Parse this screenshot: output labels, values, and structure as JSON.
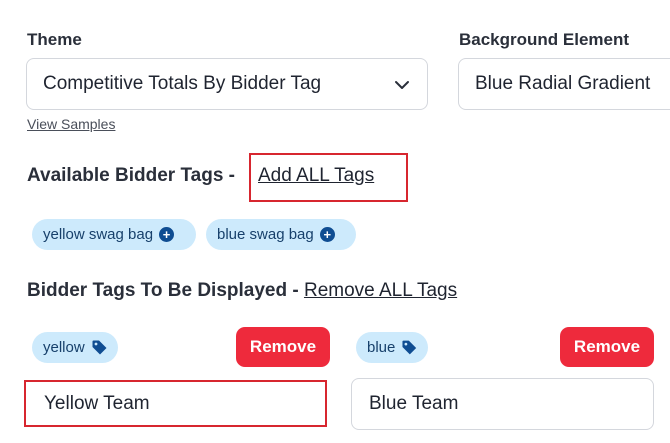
{
  "theme": {
    "label": "Theme",
    "selected": "Competitive Totals By Bidder Tag",
    "view_samples": "View Samples"
  },
  "background": {
    "label": "Background Element",
    "selected": "Blue Radial Gradient"
  },
  "available": {
    "title": "Available Bidder Tags - ",
    "add_all": "Add ALL Tags",
    "tags": [
      "yellow swag bag",
      "blue swag bag"
    ]
  },
  "displayed": {
    "title": "Bidder Tags To Be Displayed - ",
    "remove_all": "Remove ALL Tags",
    "items": [
      {
        "tag": "yellow",
        "remove_label": "Remove",
        "name": "Yellow Team"
      },
      {
        "tag": "blue",
        "remove_label": "Remove",
        "name": "Blue Team"
      }
    ]
  },
  "colors": {
    "chip_bg": "#cdeafc",
    "chip_icon": "#0f4d92",
    "remove_bg": "#ee2a3c",
    "highlight": "#d7262f"
  }
}
